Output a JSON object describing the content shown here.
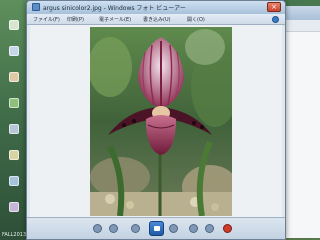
{
  "window": {
    "title": "argus sinicolor2.jpg - Windows フォト ビューアー",
    "close_label": "×"
  },
  "menu": {
    "items": [
      {
        "label": "ファイル(F)"
      },
      {
        "label": "印刷(P)"
      },
      {
        "label": "電子メール(E)"
      },
      {
        "label": "書き込み(U)"
      },
      {
        "label": "開く(O)"
      }
    ]
  },
  "desktop": {
    "caption": "FALL2013"
  },
  "photo": {
    "subject": "Paphiopedilum orchid flower"
  }
}
